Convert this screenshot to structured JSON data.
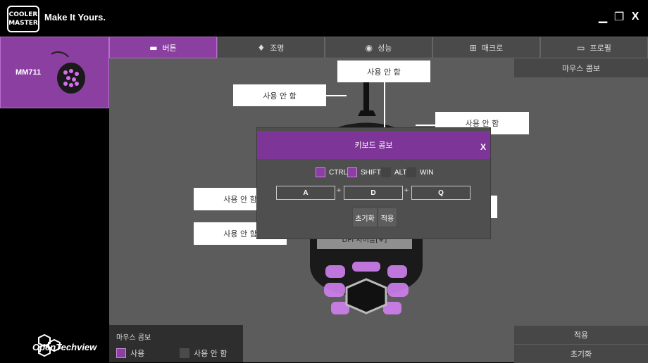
{
  "titlebar": {
    "logo_line1": "COOLER",
    "logo_line2": "MASTER",
    "slogan": "Make It Yours.",
    "minimize": "▁",
    "maximize": "❐",
    "close": "X"
  },
  "sidebar": {
    "device": "MM711",
    "brand": "OpenTechview"
  },
  "tabs": [
    {
      "label": "버튼",
      "icon": "mouse-icon"
    },
    {
      "label": "조명",
      "icon": "bulb-icon"
    },
    {
      "label": "성능",
      "icon": "gauge-icon"
    },
    {
      "label": "매크로",
      "icon": "macro-icon"
    },
    {
      "label": "프로필",
      "icon": "profile-icon"
    }
  ],
  "main": {
    "mouse_combo": "마우스 콤보",
    "button_labels": [
      "사용 안 함",
      "사용 안 함",
      "사용 안 함",
      "사용 안 함",
      "사용 안 함"
    ],
    "dpi_partial": "DPI 사이클[+]"
  },
  "dialog": {
    "title": "키보드 콤보",
    "close": "X",
    "modifiers": [
      {
        "label": "CTRL",
        "checked": true
      },
      {
        "label": "SHIFT",
        "checked": true
      },
      {
        "label": "ALT",
        "checked": false
      },
      {
        "label": "WIN",
        "checked": false
      }
    ],
    "keys": [
      "A",
      "D",
      "Q"
    ],
    "plus": "+",
    "reset": "초기화",
    "apply": "적용"
  },
  "bottom": {
    "combo_title": "마우스 콤보",
    "use": "사용",
    "not_use": "사용 안 함",
    "apply": "적용",
    "reset": "초기화"
  },
  "colors": {
    "accent": "#8a3fa1",
    "panel": "#5c5c5c",
    "dark": "#000000"
  }
}
